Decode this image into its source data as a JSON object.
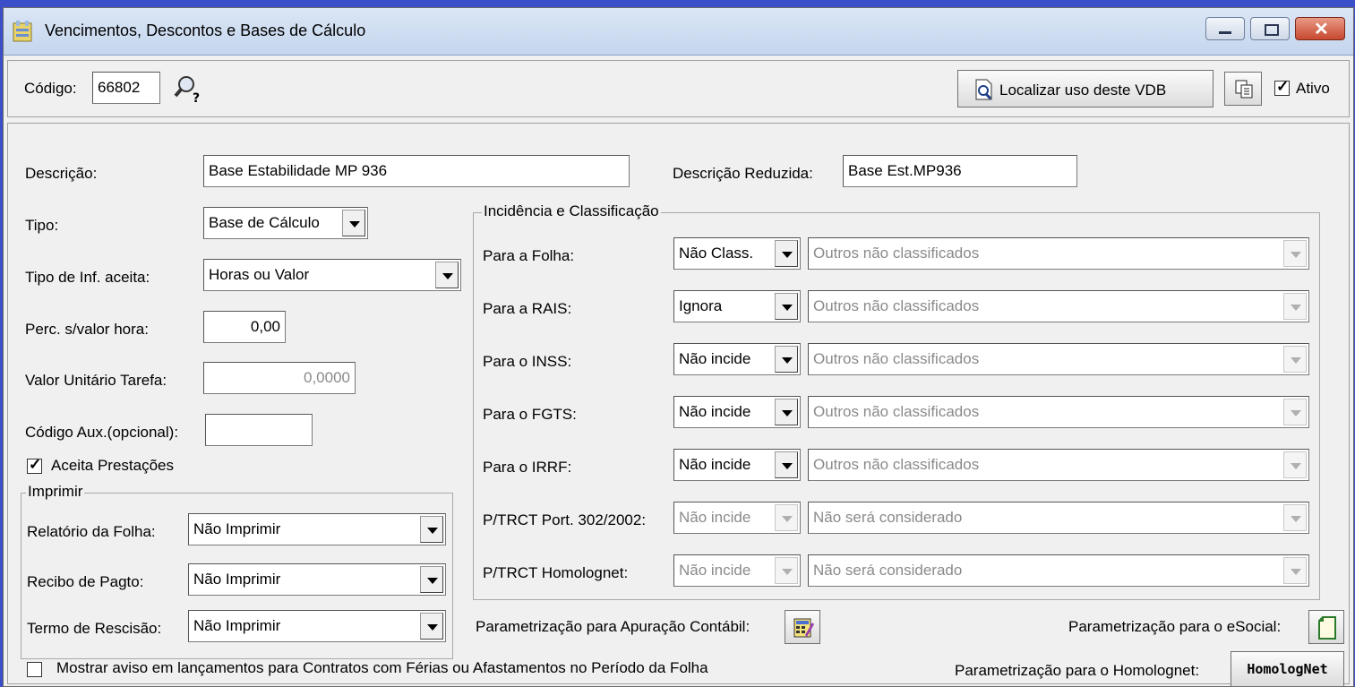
{
  "window": {
    "title": "Vencimentos, Descontos e Bases de Cálculo",
    "controls": [
      "minimize-icon",
      "maximize-icon",
      "close-icon"
    ]
  },
  "top": {
    "codigo_label": "Código:",
    "codigo_value": "66802",
    "localizar_button": "Localizar uso deste VDB",
    "ativo_label": "Ativo",
    "ativo_checked": true
  },
  "form": {
    "descricao_label": "Descrição:",
    "descricao_value": "Base Estabilidade MP 936",
    "descricao_reduzida_label": "Descrição Reduzida:",
    "descricao_reduzida_value": "Base Est.MP936",
    "tipo_label": "Tipo:",
    "tipo_value": "Base de Cálculo",
    "tipo_inf_label": "Tipo de Inf. aceita:",
    "tipo_inf_value": "Horas ou Valor",
    "perc_label": "Perc. s/valor hora:",
    "perc_value": "0,00",
    "valor_unit_label": "Valor Unitário Tarefa:",
    "valor_unit_value": "0,0000",
    "codigo_aux_label": "Código Aux.(opcional):",
    "codigo_aux_value": "",
    "aceita_prestacoes_label": "Aceita Prestações",
    "aceita_prestacoes_checked": true
  },
  "imprimir": {
    "legend": "Imprimir",
    "rows": [
      {
        "label": "Relatório da Folha:",
        "value": "Não Imprimir"
      },
      {
        "label": "Recibo de Pagto:",
        "value": "Não Imprimir"
      },
      {
        "label": "Termo de Rescisão:",
        "value": "Não Imprimir"
      }
    ]
  },
  "incidencia": {
    "legend": "Incidência e Classificação",
    "rows": [
      {
        "label": "Para a Folha:",
        "value": "Não Class.",
        "class": "Outros não classificados",
        "enabled": true
      },
      {
        "label": "Para a RAIS:",
        "value": "Ignora",
        "class": "Outros não classificados",
        "enabled": true
      },
      {
        "label": "Para o INSS:",
        "value": "Não incide",
        "class": "Outros não classificados",
        "enabled": true
      },
      {
        "label": "Para o FGTS:",
        "value": "Não incide",
        "class": "Outros não classificados",
        "enabled": true
      },
      {
        "label": "Para o IRRF:",
        "value": "Não incide",
        "class": "Outros não classificados",
        "enabled": true
      },
      {
        "label": "P/TRCT Port. 302/2002:",
        "value": "Não incide",
        "class": "Não será considerado",
        "enabled": false
      },
      {
        "label": "P/TRCT Homolognet:",
        "value": "Não incide",
        "class": "Não será considerado",
        "enabled": false
      }
    ]
  },
  "bottom": {
    "contabil_label": "Parametrização para Apuração Contábil:",
    "esocial_label": "Parametrização para o eSocial:",
    "homolognet_label": "Parametrização para o Homolognet:",
    "homolognet_button": "HomologNet",
    "aviso_label": "Mostrar aviso em lançamentos para Contratos com Férias ou Afastamentos no Período da Folha",
    "aviso_checked": false
  }
}
